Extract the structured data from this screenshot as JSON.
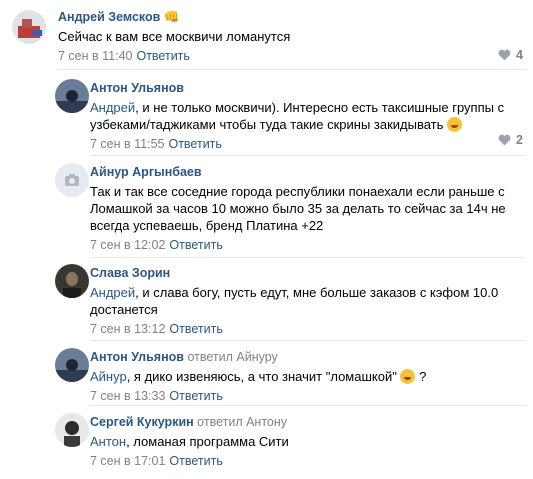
{
  "comments": [
    {
      "author": "Андрей Земсков",
      "badge": "👊",
      "text": "Сейчас к вам все москвичи ломанутся",
      "time": "7 сен в 11:40",
      "reply": "Ответить",
      "likes": "4"
    },
    {
      "author": "Антон Ульянов",
      "mention": "Андрей",
      "text": ", и не только москвичи). Интересно есть таксишные группы с узбеками/таджиками чтобы туда такие скрины закидывать",
      "emoji": "rofl-emoji",
      "time": "7 сен в 11:55",
      "reply": "Ответить",
      "likes": "2"
    },
    {
      "author": "Айнур Аргынбаев",
      "text": "Так и так все соседние города республики понаехали если раньше с Ломашкой за часов 10 можно было 35 за делать то сейчас за 14ч не всегда успеваешь, бренд Платина +22",
      "time": "7 сен в 12:02",
      "reply": "Ответить"
    },
    {
      "author": "Слава Зорин",
      "mention": "Андрей",
      "text": ", и слава богу, пусть едут, мне больше заказов с кэфом 10.0 достанется",
      "time": "7 сен в 13:12",
      "reply": "Ответить"
    },
    {
      "author": "Антон Ульянов",
      "replied_to": "ответил Айнуру",
      "mention": "Айнур",
      "text": ", я дико извеняюсь, а что значит \"ломашкой\"",
      "text_after": "?",
      "emoji": "smile-emoji",
      "time": "7 сен в 13:33",
      "reply": "Ответить"
    },
    {
      "author": "Сергей Кукуркин",
      "replied_to": "ответил Антону",
      "mention": "Антон",
      "text": ", ломаная программа Сити",
      "time": "7 сен в 17:01",
      "reply": "Ответить"
    }
  ],
  "colors": {
    "link": "#2a5885",
    "meta": "#828282",
    "divider": "#e7e8ec"
  }
}
